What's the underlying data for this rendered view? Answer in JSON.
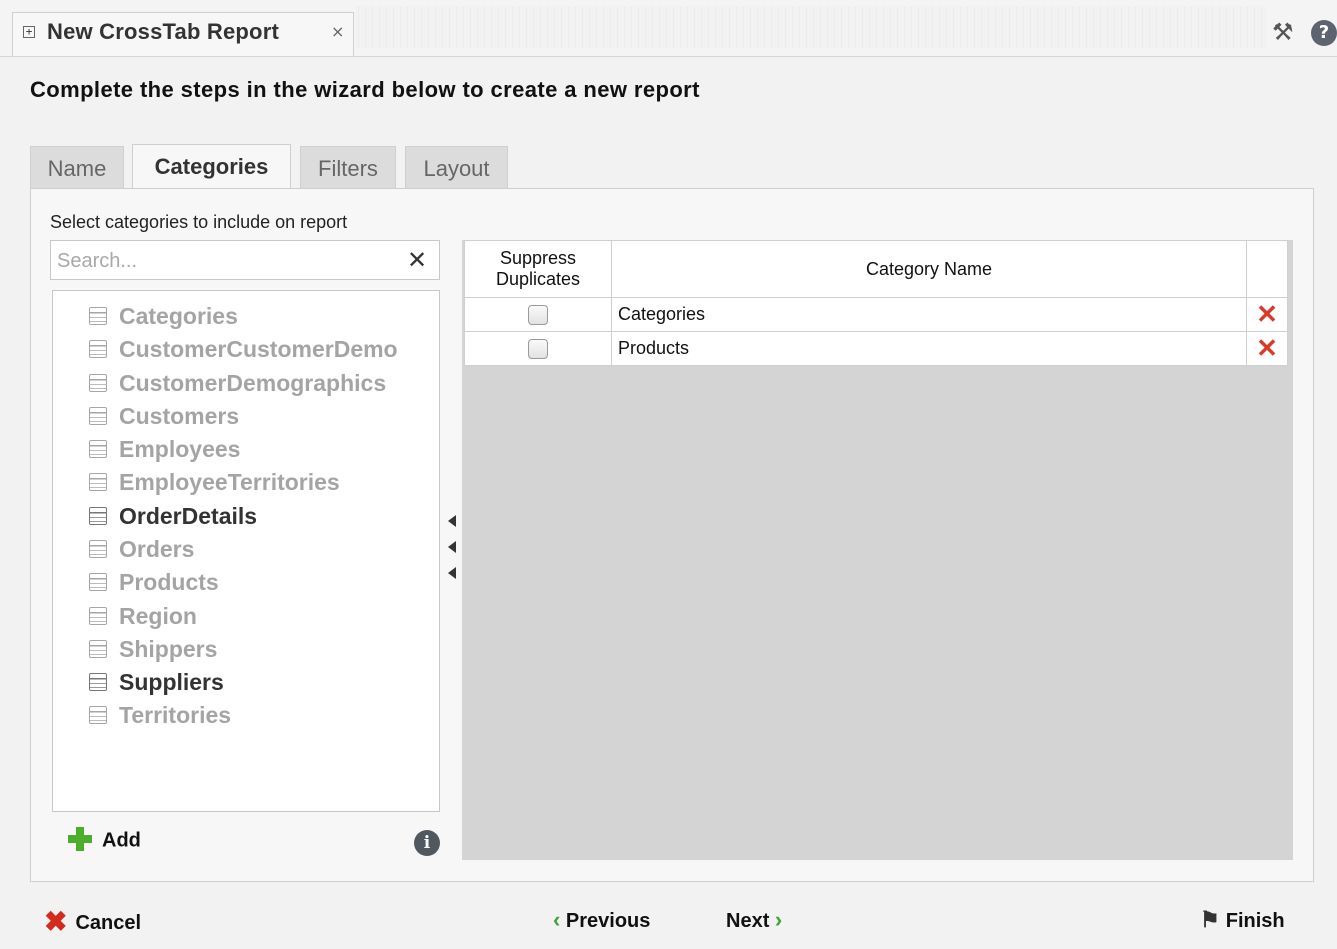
{
  "document_tab": {
    "title": "New CrossTab Report",
    "close": "×",
    "expand": "+"
  },
  "toolbar": {
    "tools_icon": "tools-icon",
    "help_icon": "help-icon",
    "help_glyph": "?"
  },
  "heading": "Complete the steps in the wizard below to create a new report",
  "wizard_tabs": [
    {
      "label": "Name",
      "active": false
    },
    {
      "label": "Categories",
      "active": true
    },
    {
      "label": "Filters",
      "active": false
    },
    {
      "label": "Layout",
      "active": false
    }
  ],
  "left_panel": {
    "instruction": "Select categories to include on report",
    "search": {
      "placeholder": "Search...",
      "value": "",
      "clear": "✕"
    },
    "tables": [
      {
        "name": "Categories",
        "available": false
      },
      {
        "name": "CustomerCustomerDemo",
        "available": false
      },
      {
        "name": "CustomerDemographics",
        "available": false
      },
      {
        "name": "Customers",
        "available": false
      },
      {
        "name": "Employees",
        "available": false
      },
      {
        "name": "EmployeeTerritories",
        "available": false
      },
      {
        "name": "OrderDetails",
        "available": true
      },
      {
        "name": "Orders",
        "available": false
      },
      {
        "name": "Products",
        "available": false
      },
      {
        "name": "Region",
        "available": false
      },
      {
        "name": "Shippers",
        "available": false
      },
      {
        "name": "Suppliers",
        "available": true
      },
      {
        "name": "Territories",
        "available": false
      }
    ],
    "add_label": "Add",
    "info_glyph": "i"
  },
  "grid": {
    "columns": {
      "suppress": "Suppress Duplicates",
      "name": "Category Name"
    },
    "rows": [
      {
        "suppress": false,
        "name": "Categories"
      },
      {
        "suppress": false,
        "name": "Products"
      }
    ],
    "delete_glyph": "✕"
  },
  "footer": {
    "cancel": "Cancel",
    "previous": "Previous",
    "next": "Next",
    "finish": "Finish",
    "prev_glyph": "‹",
    "next_glyph": "›"
  },
  "colors": {
    "accent_green": "#4cae2a",
    "delete_red": "#d43b2b"
  }
}
